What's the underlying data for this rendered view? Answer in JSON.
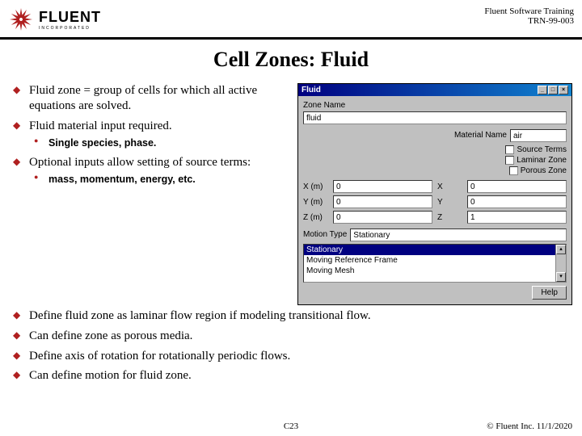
{
  "header": {
    "logo_text": "FLUENT",
    "logo_sub": "INCORPORATED",
    "training": "Fluent Software Training",
    "doc_id": "TRN-99-003"
  },
  "title": "Cell Zones: Fluid",
  "bullets": {
    "b1": "Fluid zone = group of cells for which all active equations are solved.",
    "b2": "Fluid material input required.",
    "b2s1": "Single species, phase.",
    "b3": "Optional inputs allow setting of source terms:",
    "b3s1": "mass, momentum, energy, etc.",
    "b4": "Define fluid zone as laminar flow region if modeling transitional flow.",
    "b5": "Can define zone as porous media.",
    "b6": "Define axis of rotation for rotationally periodic flows.",
    "b7": "Can define motion for fluid zone."
  },
  "dialog": {
    "title": "Fluid",
    "zone_name_label": "Zone Name",
    "zone_name_value": "fluid",
    "material_label": "Material Name",
    "material_value": "air",
    "chk_source": "Source Terms",
    "chk_laminar": "Laminar Zone",
    "chk_porous": "Porous Zone",
    "x_label": "X (m)",
    "x_val": "0",
    "x2_label": "X",
    "x2_val": "0",
    "y_label": "Y (m)",
    "y_val": "0",
    "y2_label": "Y",
    "y2_val": "0",
    "z_label": "Z (m)",
    "z_val": "0",
    "z2_label": "Z",
    "z2_val": "1",
    "motion_label": "Motion Type",
    "motion_value": "Stationary",
    "list": {
      "opt1": "Stationary",
      "opt2": "Moving Reference Frame",
      "opt3": "Moving Mesh"
    },
    "help_btn": "Help"
  },
  "footer": {
    "page": "C23",
    "copy": "© Fluent Inc. 11/1/2020"
  }
}
